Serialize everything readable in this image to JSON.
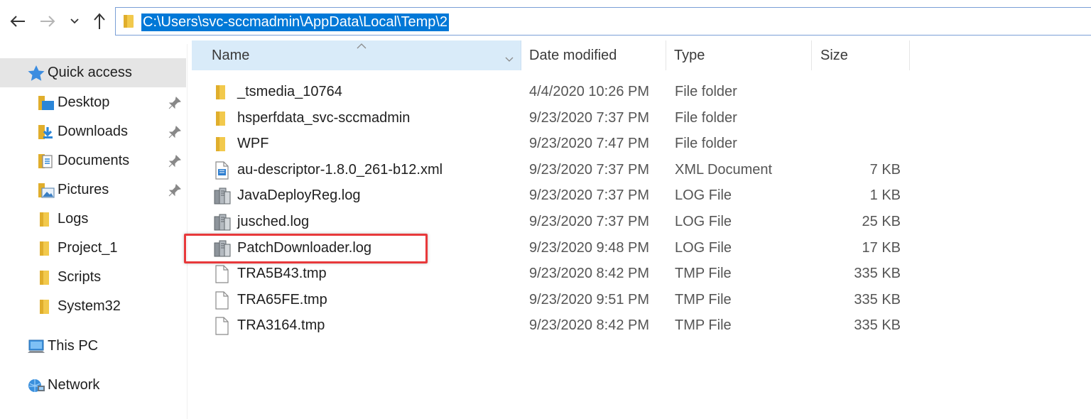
{
  "address": {
    "path": "C:\\Users\\svc-sccmadmin\\AppData\\Local\\Temp\\2"
  },
  "nav": {
    "quick_access": "Quick access",
    "pinned": [
      {
        "label": "Desktop",
        "icon": "desktop-folder-icon"
      },
      {
        "label": "Downloads",
        "icon": "downloads-folder-icon"
      },
      {
        "label": "Documents",
        "icon": "documents-folder-icon"
      },
      {
        "label": "Pictures",
        "icon": "pictures-folder-icon"
      }
    ],
    "folders": [
      {
        "label": "Logs"
      },
      {
        "label": "Project_1"
      },
      {
        "label": "Scripts"
      },
      {
        "label": "System32"
      }
    ],
    "this_pc": "This PC",
    "network": "Network"
  },
  "columns": {
    "name": "Name",
    "date": "Date modified",
    "type": "Type",
    "size": "Size"
  },
  "files": [
    {
      "name": "_tsmedia_10764",
      "date": "4/4/2020 10:26 PM",
      "type": "File folder",
      "size": "",
      "icon": "folder-icon"
    },
    {
      "name": "hsperfdata_svc-sccmadmin",
      "date": "9/23/2020 7:37 PM",
      "type": "File folder",
      "size": "",
      "icon": "folder-icon"
    },
    {
      "name": "WPF",
      "date": "9/23/2020 7:47 PM",
      "type": "File folder",
      "size": "",
      "icon": "folder-icon"
    },
    {
      "name": "au-descriptor-1.8.0_261-b12.xml",
      "date": "9/23/2020 7:37 PM",
      "type": "XML Document",
      "size": "7 KB",
      "icon": "xml-file-icon"
    },
    {
      "name": "JavaDeployReg.log",
      "date": "9/23/2020 7:37 PM",
      "type": "LOG File",
      "size": "1 KB",
      "icon": "log-file-icon"
    },
    {
      "name": "jusched.log",
      "date": "9/23/2020 7:37 PM",
      "type": "LOG File",
      "size": "25 KB",
      "icon": "log-file-icon"
    },
    {
      "name": "PatchDownloader.log",
      "date": "9/23/2020 9:48 PM",
      "type": "LOG File",
      "size": "17 KB",
      "icon": "log-file-icon"
    },
    {
      "name": "TRA5B43.tmp",
      "date": "9/23/2020 8:42 PM",
      "type": "TMP File",
      "size": "335 KB",
      "icon": "blank-file-icon"
    },
    {
      "name": "TRA65FE.tmp",
      "date": "9/23/2020 9:51 PM",
      "type": "TMP File",
      "size": "335 KB",
      "icon": "blank-file-icon"
    },
    {
      "name": "TRA3164.tmp",
      "date": "9/23/2020 8:42 PM",
      "type": "TMP File",
      "size": "335 KB",
      "icon": "blank-file-icon"
    }
  ],
  "colors": {
    "selection": "#0078d7",
    "header_highlight": "#d9ebf9",
    "annotation": "#e8393b",
    "folder": "#f2c94c"
  }
}
